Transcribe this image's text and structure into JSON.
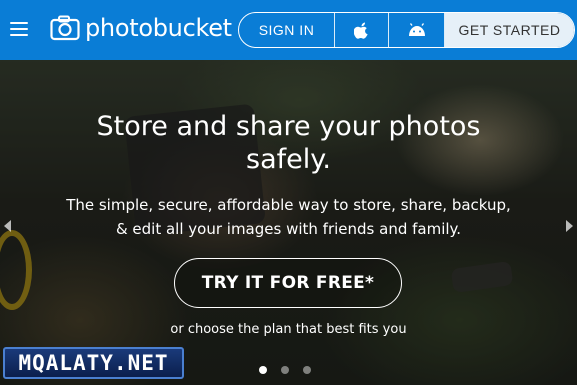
{
  "header": {
    "logo_text": "photobucket",
    "menu_icon": "hamburger-menu-icon",
    "sign_in_label": "SIGN IN",
    "apple_icon": "apple-icon",
    "android_icon": "android-icon",
    "get_started_label": "GET STARTED",
    "brand_color": "#0a7dd6"
  },
  "hero": {
    "headline_line1": "Store and share your photos",
    "headline_line2": "safely.",
    "subtext_line1": "The simple, secure, affordable way to store, share, backup,",
    "subtext_line2": "& edit all your images with friends and family.",
    "cta_label": "TRY IT FOR FREE*",
    "plan_link_text": "or choose the plan that best fits you",
    "carousel_dots": [
      {
        "active": true
      },
      {
        "active": false
      },
      {
        "active": false
      }
    ]
  },
  "watermark": {
    "text": "MQALATY.NET"
  }
}
